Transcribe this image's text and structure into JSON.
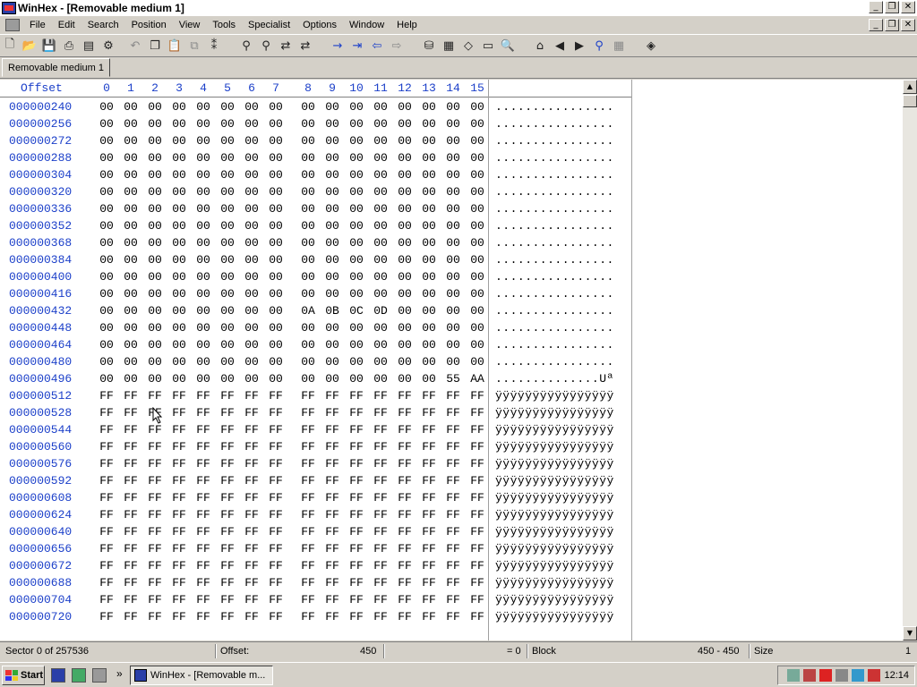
{
  "window": {
    "title": "WinHex - [Removable medium 1]",
    "buttons": [
      "_",
      "❐",
      "✕"
    ]
  },
  "menu": [
    "File",
    "Edit",
    "Search",
    "Position",
    "View",
    "Tools",
    "Specialist",
    "Options",
    "Window",
    "Help"
  ],
  "tab": {
    "label": "Removable medium 1"
  },
  "editor": {
    "offset_header": "Offset",
    "columns": [
      "0",
      "1",
      "2",
      "3",
      "4",
      "5",
      "6",
      "7",
      "8",
      "9",
      "10",
      "11",
      "12",
      "13",
      "14",
      "15"
    ],
    "rows": [
      {
        "offset": "000000240",
        "bytes": [
          "00",
          "00",
          "00",
          "00",
          "00",
          "00",
          "00",
          "00",
          "00",
          "00",
          "00",
          "00",
          "00",
          "00",
          "00",
          "00"
        ],
        "ascii": "................"
      },
      {
        "offset": "000000256",
        "bytes": [
          "00",
          "00",
          "00",
          "00",
          "00",
          "00",
          "00",
          "00",
          "00",
          "00",
          "00",
          "00",
          "00",
          "00",
          "00",
          "00"
        ],
        "ascii": "................"
      },
      {
        "offset": "000000272",
        "bytes": [
          "00",
          "00",
          "00",
          "00",
          "00",
          "00",
          "00",
          "00",
          "00",
          "00",
          "00",
          "00",
          "00",
          "00",
          "00",
          "00"
        ],
        "ascii": "................"
      },
      {
        "offset": "000000288",
        "bytes": [
          "00",
          "00",
          "00",
          "00",
          "00",
          "00",
          "00",
          "00",
          "00",
          "00",
          "00",
          "00",
          "00",
          "00",
          "00",
          "00"
        ],
        "ascii": "................"
      },
      {
        "offset": "000000304",
        "bytes": [
          "00",
          "00",
          "00",
          "00",
          "00",
          "00",
          "00",
          "00",
          "00",
          "00",
          "00",
          "00",
          "00",
          "00",
          "00",
          "00"
        ],
        "ascii": "................"
      },
      {
        "offset": "000000320",
        "bytes": [
          "00",
          "00",
          "00",
          "00",
          "00",
          "00",
          "00",
          "00",
          "00",
          "00",
          "00",
          "00",
          "00",
          "00",
          "00",
          "00"
        ],
        "ascii": "................"
      },
      {
        "offset": "000000336",
        "bytes": [
          "00",
          "00",
          "00",
          "00",
          "00",
          "00",
          "00",
          "00",
          "00",
          "00",
          "00",
          "00",
          "00",
          "00",
          "00",
          "00"
        ],
        "ascii": "................"
      },
      {
        "offset": "000000352",
        "bytes": [
          "00",
          "00",
          "00",
          "00",
          "00",
          "00",
          "00",
          "00",
          "00",
          "00",
          "00",
          "00",
          "00",
          "00",
          "00",
          "00"
        ],
        "ascii": "................"
      },
      {
        "offset": "000000368",
        "bytes": [
          "00",
          "00",
          "00",
          "00",
          "00",
          "00",
          "00",
          "00",
          "00",
          "00",
          "00",
          "00",
          "00",
          "00",
          "00",
          "00"
        ],
        "ascii": "................"
      },
      {
        "offset": "000000384",
        "bytes": [
          "00",
          "00",
          "00",
          "00",
          "00",
          "00",
          "00",
          "00",
          "00",
          "00",
          "00",
          "00",
          "00",
          "00",
          "00",
          "00"
        ],
        "ascii": "................"
      },
      {
        "offset": "000000400",
        "bytes": [
          "00",
          "00",
          "00",
          "00",
          "00",
          "00",
          "00",
          "00",
          "00",
          "00",
          "00",
          "00",
          "00",
          "00",
          "00",
          "00"
        ],
        "ascii": "................"
      },
      {
        "offset": "000000416",
        "bytes": [
          "00",
          "00",
          "00",
          "00",
          "00",
          "00",
          "00",
          "00",
          "00",
          "00",
          "00",
          "00",
          "00",
          "00",
          "00",
          "00"
        ],
        "ascii": "................"
      },
      {
        "offset": "000000432",
        "bytes": [
          "00",
          "00",
          "00",
          "00",
          "00",
          "00",
          "00",
          "00",
          "0A",
          "0B",
          "0C",
          "0D",
          "00",
          "00",
          "00",
          "00"
        ],
        "ascii": "................"
      },
      {
        "offset": "000000448",
        "bytes": [
          "00",
          "00",
          "00",
          "00",
          "00",
          "00",
          "00",
          "00",
          "00",
          "00",
          "00",
          "00",
          "00",
          "00",
          "00",
          "00"
        ],
        "ascii": "................"
      },
      {
        "offset": "000000464",
        "bytes": [
          "00",
          "00",
          "00",
          "00",
          "00",
          "00",
          "00",
          "00",
          "00",
          "00",
          "00",
          "00",
          "00",
          "00",
          "00",
          "00"
        ],
        "ascii": "................"
      },
      {
        "offset": "000000480",
        "bytes": [
          "00",
          "00",
          "00",
          "00",
          "00",
          "00",
          "00",
          "00",
          "00",
          "00",
          "00",
          "00",
          "00",
          "00",
          "00",
          "00"
        ],
        "ascii": "................"
      },
      {
        "offset": "000000496",
        "bytes": [
          "00",
          "00",
          "00",
          "00",
          "00",
          "00",
          "00",
          "00",
          "00",
          "00",
          "00",
          "00",
          "00",
          "00",
          "55",
          "AA"
        ],
        "ascii": "..............Uª"
      },
      {
        "offset": "000000512",
        "bytes": [
          "FF",
          "FF",
          "FF",
          "FF",
          "FF",
          "FF",
          "FF",
          "FF",
          "FF",
          "FF",
          "FF",
          "FF",
          "FF",
          "FF",
          "FF",
          "FF"
        ],
        "ascii": "ÿÿÿÿÿÿÿÿÿÿÿÿÿÿÿÿ"
      },
      {
        "offset": "000000528",
        "bytes": [
          "FF",
          "FF",
          "FF",
          "FF",
          "FF",
          "FF",
          "FF",
          "FF",
          "FF",
          "FF",
          "FF",
          "FF",
          "FF",
          "FF",
          "FF",
          "FF"
        ],
        "ascii": "ÿÿÿÿÿÿÿÿÿÿÿÿÿÿÿÿ"
      },
      {
        "offset": "000000544",
        "bytes": [
          "FF",
          "FF",
          "FF",
          "FF",
          "FF",
          "FF",
          "FF",
          "FF",
          "FF",
          "FF",
          "FF",
          "FF",
          "FF",
          "FF",
          "FF",
          "FF"
        ],
        "ascii": "ÿÿÿÿÿÿÿÿÿÿÿÿÿÿÿÿ"
      },
      {
        "offset": "000000560",
        "bytes": [
          "FF",
          "FF",
          "FF",
          "FF",
          "FF",
          "FF",
          "FF",
          "FF",
          "FF",
          "FF",
          "FF",
          "FF",
          "FF",
          "FF",
          "FF",
          "FF"
        ],
        "ascii": "ÿÿÿÿÿÿÿÿÿÿÿÿÿÿÿÿ"
      },
      {
        "offset": "000000576",
        "bytes": [
          "FF",
          "FF",
          "FF",
          "FF",
          "FF",
          "FF",
          "FF",
          "FF",
          "FF",
          "FF",
          "FF",
          "FF",
          "FF",
          "FF",
          "FF",
          "FF"
        ],
        "ascii": "ÿÿÿÿÿÿÿÿÿÿÿÿÿÿÿÿ"
      },
      {
        "offset": "000000592",
        "bytes": [
          "FF",
          "FF",
          "FF",
          "FF",
          "FF",
          "FF",
          "FF",
          "FF",
          "FF",
          "FF",
          "FF",
          "FF",
          "FF",
          "FF",
          "FF",
          "FF"
        ],
        "ascii": "ÿÿÿÿÿÿÿÿÿÿÿÿÿÿÿÿ"
      },
      {
        "offset": "000000608",
        "bytes": [
          "FF",
          "FF",
          "FF",
          "FF",
          "FF",
          "FF",
          "FF",
          "FF",
          "FF",
          "FF",
          "FF",
          "FF",
          "FF",
          "FF",
          "FF",
          "FF"
        ],
        "ascii": "ÿÿÿÿÿÿÿÿÿÿÿÿÿÿÿÿ"
      },
      {
        "offset": "000000624",
        "bytes": [
          "FF",
          "FF",
          "FF",
          "FF",
          "FF",
          "FF",
          "FF",
          "FF",
          "FF",
          "FF",
          "FF",
          "FF",
          "FF",
          "FF",
          "FF",
          "FF"
        ],
        "ascii": "ÿÿÿÿÿÿÿÿÿÿÿÿÿÿÿÿ"
      },
      {
        "offset": "000000640",
        "bytes": [
          "FF",
          "FF",
          "FF",
          "FF",
          "FF",
          "FF",
          "FF",
          "FF",
          "FF",
          "FF",
          "FF",
          "FF",
          "FF",
          "FF",
          "FF",
          "FF"
        ],
        "ascii": "ÿÿÿÿÿÿÿÿÿÿÿÿÿÿÿÿ"
      },
      {
        "offset": "000000656",
        "bytes": [
          "FF",
          "FF",
          "FF",
          "FF",
          "FF",
          "FF",
          "FF",
          "FF",
          "FF",
          "FF",
          "FF",
          "FF",
          "FF",
          "FF",
          "FF",
          "FF"
        ],
        "ascii": "ÿÿÿÿÿÿÿÿÿÿÿÿÿÿÿÿ"
      },
      {
        "offset": "000000672",
        "bytes": [
          "FF",
          "FF",
          "FF",
          "FF",
          "FF",
          "FF",
          "FF",
          "FF",
          "FF",
          "FF",
          "FF",
          "FF",
          "FF",
          "FF",
          "FF",
          "FF"
        ],
        "ascii": "ÿÿÿÿÿÿÿÿÿÿÿÿÿÿÿÿ"
      },
      {
        "offset": "000000688",
        "bytes": [
          "FF",
          "FF",
          "FF",
          "FF",
          "FF",
          "FF",
          "FF",
          "FF",
          "FF",
          "FF",
          "FF",
          "FF",
          "FF",
          "FF",
          "FF",
          "FF"
        ],
        "ascii": "ÿÿÿÿÿÿÿÿÿÿÿÿÿÿÿÿ"
      },
      {
        "offset": "000000704",
        "bytes": [
          "FF",
          "FF",
          "FF",
          "FF",
          "FF",
          "FF",
          "FF",
          "FF",
          "FF",
          "FF",
          "FF",
          "FF",
          "FF",
          "FF",
          "FF",
          "FF"
        ],
        "ascii": "ÿÿÿÿÿÿÿÿÿÿÿÿÿÿÿÿ"
      },
      {
        "offset": "000000720",
        "bytes": [
          "FF",
          "FF",
          "FF",
          "FF",
          "FF",
          "FF",
          "FF",
          "FF",
          "FF",
          "FF",
          "FF",
          "FF",
          "FF",
          "FF",
          "FF",
          "FF"
        ],
        "ascii": "ÿÿÿÿÿÿÿÿÿÿÿÿÿÿÿÿ"
      }
    ]
  },
  "statusbar": {
    "sector": "Sector 0 of 257536",
    "offset_label": "Offset:",
    "offset_value": "450",
    "value": "= 0",
    "block_label": "Block",
    "block_range": "450 - 450",
    "size_label": "Size",
    "size_value": "1"
  },
  "taskbar": {
    "start_label": "Start",
    "task_label": "WinHex - [Removable m...",
    "clock": "12:14"
  },
  "icons": {
    "toolbar": [
      "new-file-icon",
      "open-icon",
      "save-icon",
      "print-icon",
      "properties-icon",
      "run-icon",
      "undo-icon",
      "copy-icon",
      "paste-icon",
      "paste-special-icon",
      "edit-data-icon",
      "find-text-icon",
      "find-hex-icon",
      "replace-text-icon",
      "replace-hex-icon",
      "goto-offset-icon",
      "goto-sector-icon",
      "back-icon",
      "forward-icon",
      "open-disk-icon",
      "disk-map-icon",
      "clone-disk-icon",
      "ram-icon",
      "zoom-icon",
      "directory-icon",
      "prev-icon",
      "next-icon",
      "search-binoculars-icon",
      "table-icon",
      "help-book-icon"
    ]
  },
  "colors": {
    "offset_blue": "#1b3fc9",
    "chrome": "#d4d0c8"
  }
}
